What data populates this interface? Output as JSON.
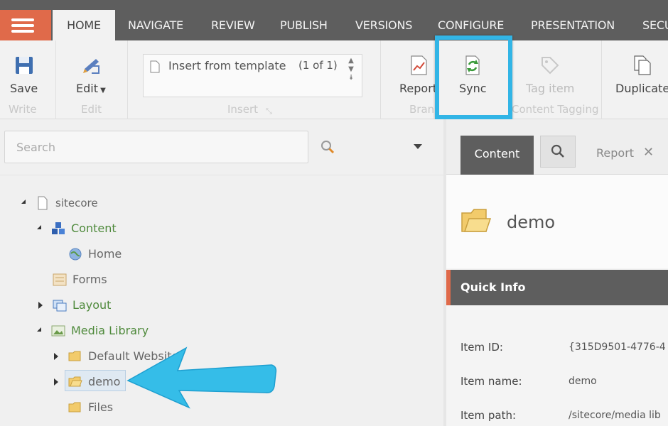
{
  "topbar": {
    "tabs": [
      {
        "label": "HOME",
        "active": true
      },
      {
        "label": "NAVIGATE"
      },
      {
        "label": "REVIEW"
      },
      {
        "label": "PUBLISH"
      },
      {
        "label": "VERSIONS"
      },
      {
        "label": "CONFIGURE"
      },
      {
        "label": "PRESENTATION"
      },
      {
        "label": "SECU"
      }
    ]
  },
  "ribbon": {
    "save": "Save",
    "edit": "Edit",
    "insert_template": "Insert from template",
    "insert_count": "(1 of 1)",
    "report": "Report",
    "sync": "Sync",
    "tag_item": "Tag item",
    "duplicate": "Duplicate",
    "groups": {
      "write": "Write",
      "edit": "Edit",
      "insert": "Insert",
      "branches": "Bran",
      "content_tagging": "Content Tagging"
    }
  },
  "search": {
    "placeholder": "Search"
  },
  "tree": [
    {
      "label": "sitecore",
      "icon": "document-icon",
      "toggle": "open"
    },
    {
      "label": "Content",
      "icon": "content-cubes-icon",
      "toggle": "open"
    },
    {
      "label": "Home",
      "icon": "globe-icon",
      "toggle": "none"
    },
    {
      "label": "Forms",
      "icon": "forms-icon",
      "toggle": "none"
    },
    {
      "label": "Layout",
      "icon": "layout-icon",
      "toggle": "closed"
    },
    {
      "label": "Media Library",
      "icon": "image-icon",
      "toggle": "open"
    },
    {
      "label": "Default Website",
      "icon": "folder-icon",
      "toggle": "closed"
    },
    {
      "label": "demo",
      "icon": "folder-open-icon",
      "toggle": "closed",
      "selected": true
    },
    {
      "label": "Files",
      "icon": "folder-icon",
      "toggle": "none"
    }
  ],
  "right": {
    "tabs": {
      "content": "Content",
      "report": "Report"
    },
    "item_title": "demo",
    "quick_info": "Quick Info",
    "fields": [
      {
        "label": "Item ID:",
        "value": "{315D9501-4776-4"
      },
      {
        "label": "Item name:",
        "value": "demo"
      },
      {
        "label": "Item path:",
        "value": "/sitecore/media lib"
      }
    ]
  },
  "colors": {
    "accent": "#e06a4a",
    "highlight": "#32b5e6",
    "topbar": "#5e5e5e"
  }
}
